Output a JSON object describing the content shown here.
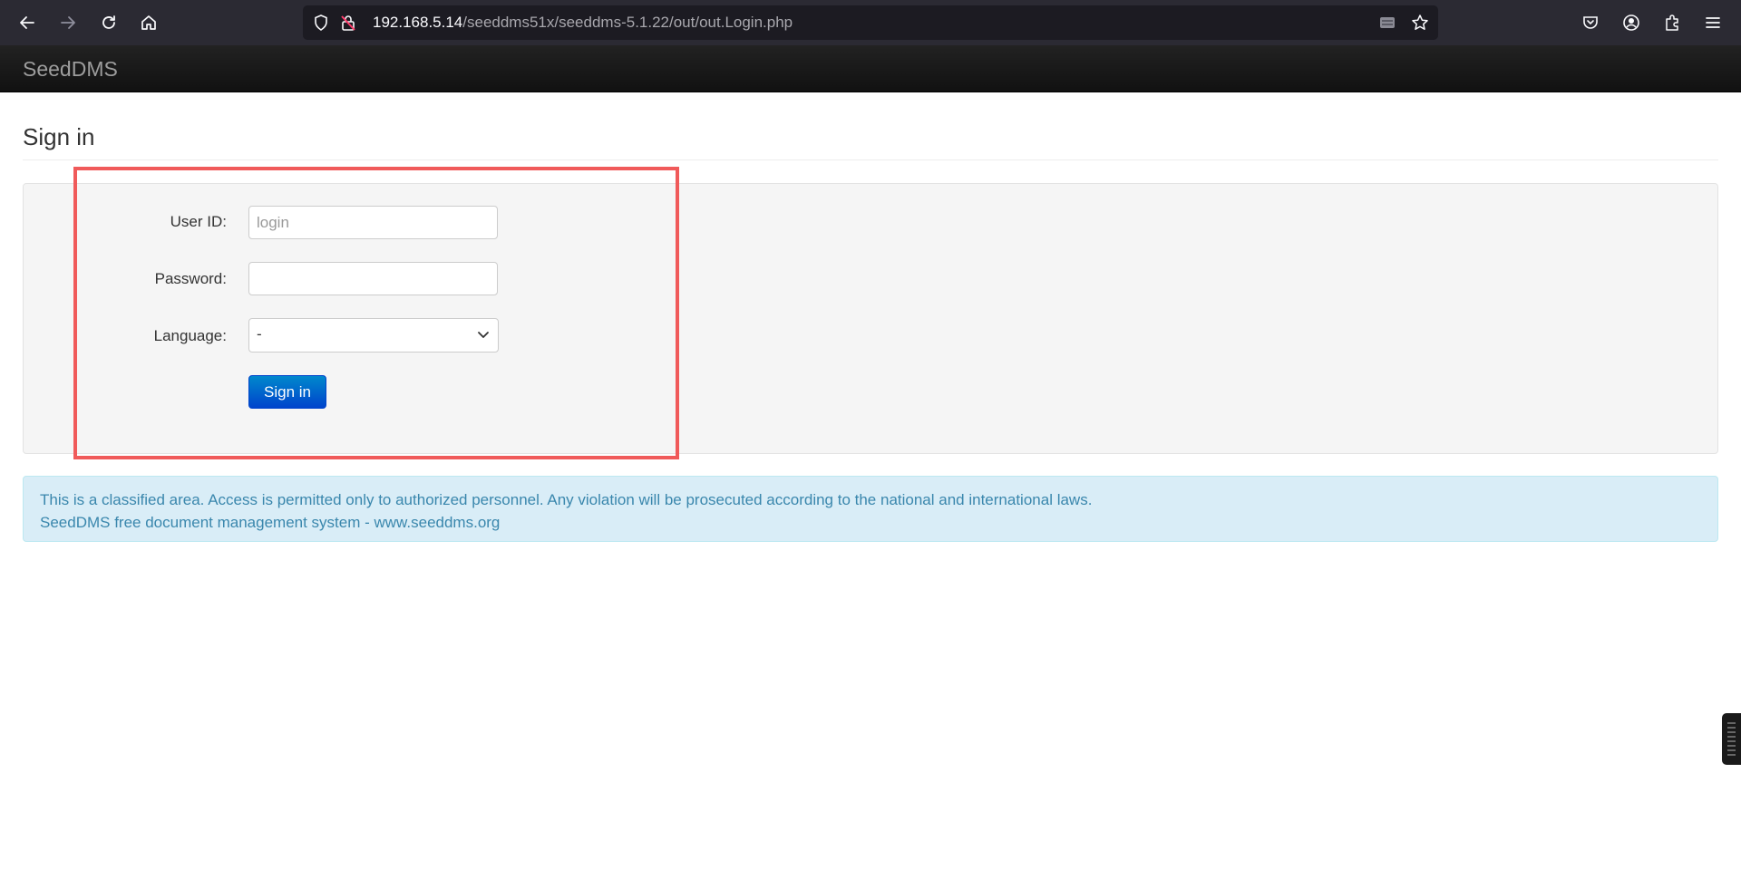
{
  "browser": {
    "url_host": "192.168.5.14",
    "url_path": "/seeddms51x/seeddms-5.1.22/out/out.Login.php"
  },
  "navbar": {
    "brand": "SeedDMS"
  },
  "page": {
    "title": "Sign in"
  },
  "form": {
    "user_id_label": "User ID:",
    "user_id_placeholder": "login",
    "user_id_value": "",
    "password_label": "Password:",
    "password_value": "",
    "language_label": "Language:",
    "language_selected": "-",
    "submit_label": "Sign in"
  },
  "notice": {
    "line1": "This is a classified area. Access is permitted only to authorized personnel. Any violation will be prosecuted according to the national and international laws.",
    "line2": "SeedDMS free document management system - www.seeddms.org"
  },
  "colors": {
    "highlight": "#f05a5a",
    "primary": "#0044cc",
    "notice_text": "#3a87ad"
  }
}
